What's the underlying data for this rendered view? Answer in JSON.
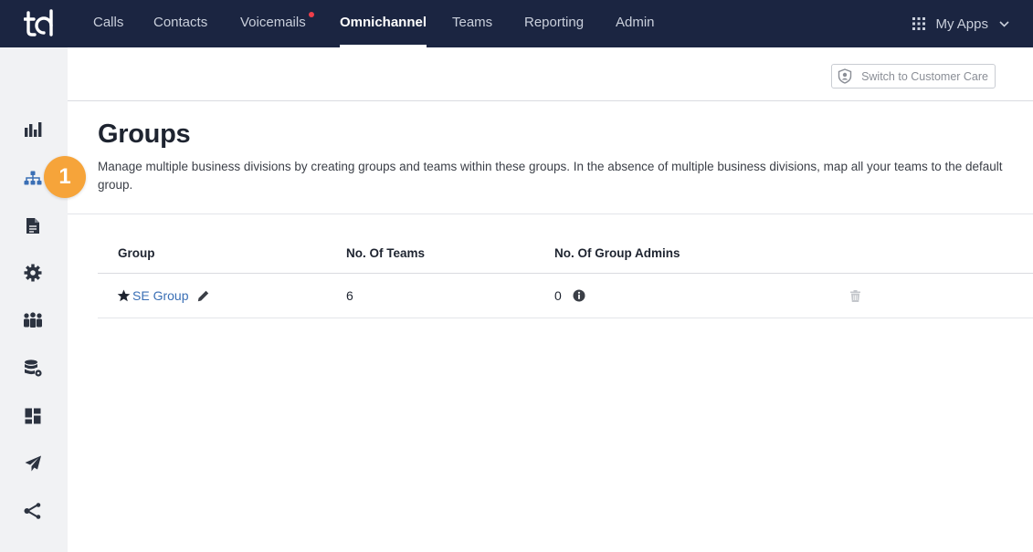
{
  "brand": {
    "logo_text": "tdl"
  },
  "topnav": {
    "items": [
      {
        "label": "Calls"
      },
      {
        "label": "Contacts"
      },
      {
        "label": "Voicemails"
      },
      {
        "label": "Omnichannel"
      },
      {
        "label": "Teams"
      },
      {
        "label": "Reporting"
      },
      {
        "label": "Admin"
      }
    ],
    "active": "Omnichannel",
    "myapps_label": "My Apps"
  },
  "header": {
    "switch_button_label": "Switch to Customer Care"
  },
  "step_badge": "1",
  "page": {
    "title": "Groups",
    "description": "Manage multiple business divisions by creating groups and teams within these groups. In the absence of multiple business divisions, map all your teams to the default group."
  },
  "table": {
    "columns": [
      "Group",
      "No. Of Teams",
      "No. Of Group Admins"
    ],
    "rows": [
      {
        "name": "SE Group",
        "teams": "6",
        "admins": "0"
      }
    ]
  },
  "colors": {
    "nav_bg": "#1b2541",
    "sidebar_bg": "#f1f2f4",
    "active_sidebar_icon": "#3a6fb5",
    "badge": "#f6a43a",
    "link": "#3a6fb5",
    "notification_dot": "#ef3e4a"
  },
  "sidebar_icons": [
    "bar-chart-icon",
    "org-chart-icon",
    "document-icon",
    "gear-icon",
    "people-icon",
    "database-settings-icon",
    "dashboard-icon",
    "paper-plane-icon",
    "share-icon"
  ]
}
